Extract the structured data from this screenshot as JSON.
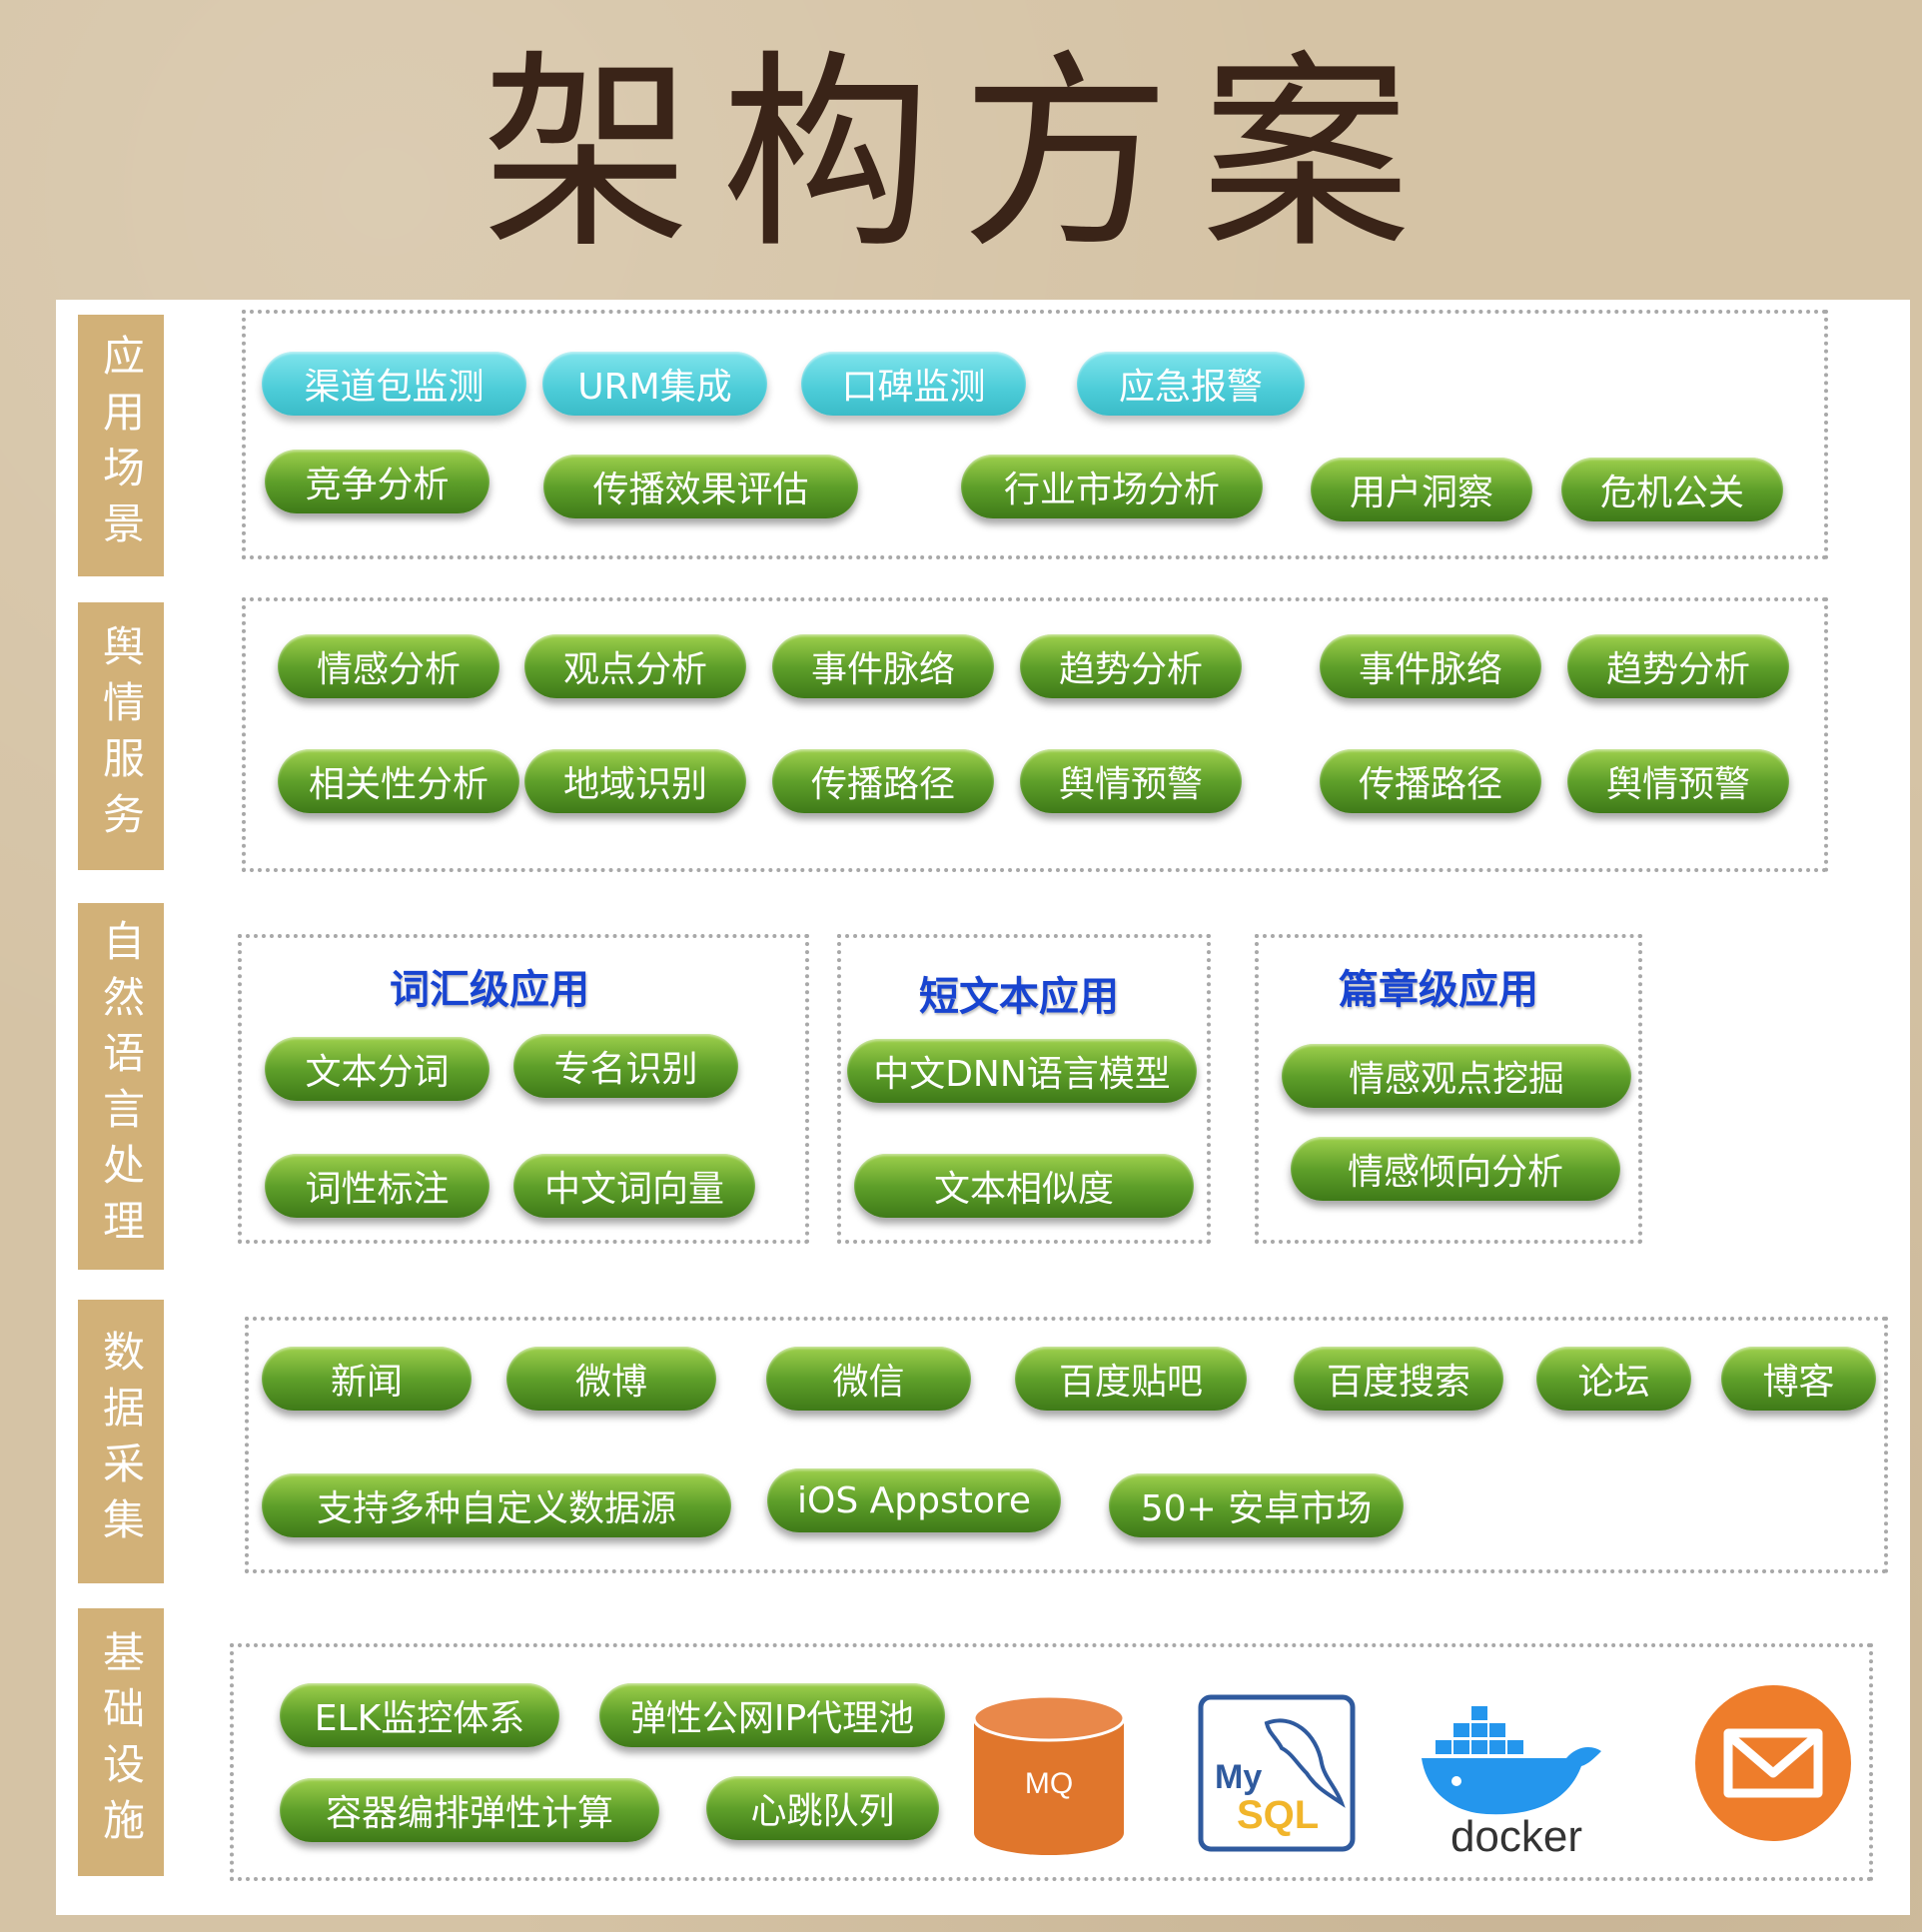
{
  "title": "架构方案",
  "layers": [
    {
      "label": "应用场景",
      "items": [
        {
          "text": "渠道包监测",
          "style": "cyan"
        },
        {
          "text": "URM集成",
          "style": "cyan"
        },
        {
          "text": "口碑监测",
          "style": "cyan"
        },
        {
          "text": "应急报警",
          "style": "cyan"
        },
        {
          "text": "竞争分析"
        },
        {
          "text": "传播效果评估"
        },
        {
          "text": "行业市场分析"
        },
        {
          "text": "用户洞察"
        },
        {
          "text": "危机公关"
        }
      ]
    },
    {
      "label": "舆情服务",
      "items": [
        {
          "text": "情感分析"
        },
        {
          "text": "观点分析"
        },
        {
          "text": "事件脉络"
        },
        {
          "text": "趋势分析"
        },
        {
          "text": "事件脉络"
        },
        {
          "text": "趋势分析"
        },
        {
          "text": "相关性分析"
        },
        {
          "text": "地域识别"
        },
        {
          "text": "传播路径"
        },
        {
          "text": "舆情预警"
        },
        {
          "text": "传播路径"
        },
        {
          "text": "舆情预警"
        }
      ]
    },
    {
      "label": "自然语言处理",
      "groups": [
        {
          "heading": "词汇级应用",
          "items": [
            "文本分词",
            "专名识别",
            "词性标注",
            "中文词向量"
          ]
        },
        {
          "heading": "短文本应用",
          "items": [
            "中文DNN语言模型",
            "文本相似度"
          ]
        },
        {
          "heading": "篇章级应用",
          "items": [
            "情感观点挖掘",
            "情感倾向分析"
          ]
        }
      ]
    },
    {
      "label": "数据采集",
      "items": [
        {
          "text": "新闻"
        },
        {
          "text": "微博"
        },
        {
          "text": "微信"
        },
        {
          "text": "百度贴吧"
        },
        {
          "text": "百度搜索"
        },
        {
          "text": "论坛"
        },
        {
          "text": "博客"
        },
        {
          "text": "支持多种自定义数据源"
        },
        {
          "text": "iOS Appstore"
        },
        {
          "text": "50+ 安卓市场"
        }
      ]
    },
    {
      "label": "基础设施",
      "items": [
        {
          "text": "ELK监控体系"
        },
        {
          "text": "弹性公网IP代理池"
        },
        {
          "text": "容器编排弹性计算"
        },
        {
          "text": "心跳队列"
        }
      ],
      "logos": [
        {
          "name": "mq-cylinder-icon",
          "text": "MQ",
          "color": "#e0762c"
        },
        {
          "name": "mysql-logo",
          "text_my": "My",
          "text_sql": "SQL",
          "color": "#2f5a9e"
        },
        {
          "name": "docker-logo",
          "text": "docker",
          "color": "#2496ed"
        },
        {
          "name": "mail-icon",
          "color": "#ee7d2b"
        }
      ]
    }
  ]
}
